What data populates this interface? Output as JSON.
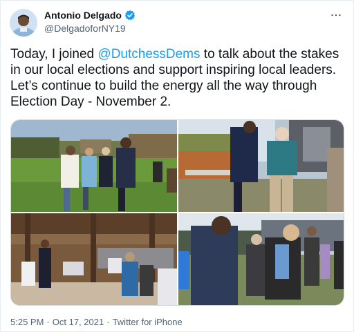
{
  "author": {
    "name": "Antonio Delgado",
    "handle": "@DelgadoforNY19",
    "verified": true
  },
  "tweet": {
    "text_before": "Today, I joined ",
    "mention": "@DutchessDems",
    "text_after": " to talk about the stakes in our local elections and support inspiring local leaders. Let’s continue to build the energy all the way through Election Day - November 2."
  },
  "media": {
    "photos": [
      {
        "icon": "outdoor-greeting-photo"
      },
      {
        "icon": "garden-handshake-photo"
      },
      {
        "icon": "barn-interior-photo"
      },
      {
        "icon": "outdoor-handshake-photo"
      }
    ]
  },
  "meta": {
    "time": "5:25 PM",
    "separator1": "·",
    "date": "Oct 17, 2021",
    "separator2": "·",
    "source": "Twitter for iPhone"
  },
  "colors": {
    "accent": "#1d9bf0",
    "text": "#0f1419",
    "secondary": "#536471"
  }
}
